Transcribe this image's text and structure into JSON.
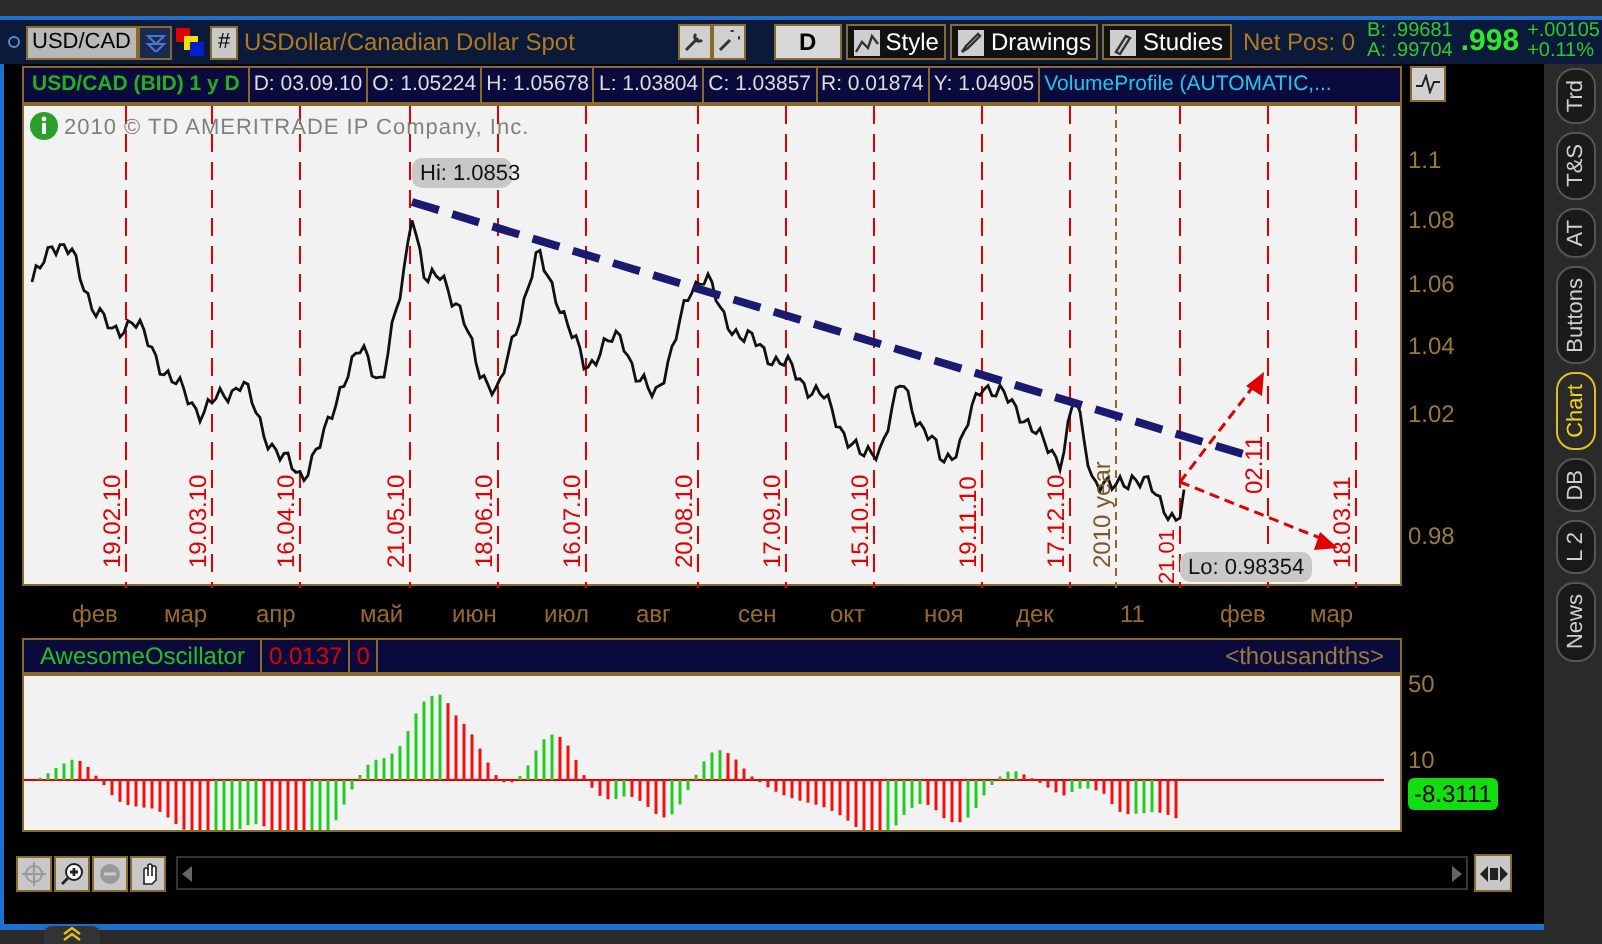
{
  "toolbar": {
    "symbol": "USD/CAD",
    "hash_button": "#",
    "description": "USDollar/Canadian Dollar Spot",
    "period_button": "D",
    "buttons": [
      "Style",
      "Drawings",
      "Studies"
    ],
    "net_position": "Net Pos: 0",
    "bid": "B: .99681",
    "ask": "A: .99704",
    "last": ".998",
    "change": "+.00105",
    "change_percent": "+0.11%"
  },
  "chart_header": {
    "title": "USD/CAD (BID) 1 y D",
    "fields": [
      "D: 03.09.10",
      "O: 1.05224",
      "H: 1.05678",
      "L: 1.03804",
      "C: 1.03857",
      "R: 0.01874",
      "Y: 1.04905"
    ],
    "study": "VolumeProfile (AUTOMATIC,..."
  },
  "copyright": "2010 © TD AMERITRADE IP Company, Inc.",
  "price_axis": [
    "1.1",
    "1.08",
    "1.06",
    "1.04",
    "1.02",
    "0.98"
  ],
  "date_markers": [
    "19.02.10",
    "19.03.10",
    "16.04.10",
    "21.05.10",
    "18.06.10",
    "16.07.10",
    "20.08.10",
    "17.09.10",
    "15.10.10",
    "19.11.10",
    "17.12.10",
    "21.01",
    "02.11",
    "18.03.11"
  ],
  "year_marker": "2010 year",
  "high_label": "Hi: 1.0853",
  "low_label": "Lo: 0.98354",
  "months": [
    "фев",
    "мар",
    "апр",
    "май",
    "июн",
    "июл",
    "авг",
    "сен",
    "окт",
    "ноя",
    "дек",
    "11",
    "фев",
    "мар"
  ],
  "oscillator": {
    "name": "AwesomeOscillator",
    "value": "0.0137",
    "field_3": "0",
    "units": "<thousandths>",
    "scale": [
      "50",
      "10"
    ],
    "current": "-8.3111"
  },
  "side_tabs": [
    {
      "label": "Trd",
      "selected": false
    },
    {
      "label": "T&S",
      "selected": false
    },
    {
      "label": "AT",
      "selected": false
    },
    {
      "label": "Buttons",
      "selected": false
    },
    {
      "label": "Chart",
      "selected": true
    },
    {
      "label": "DB",
      "selected": false
    },
    {
      "label": "L 2",
      "selected": false
    },
    {
      "label": "News",
      "selected": false
    }
  ]
}
